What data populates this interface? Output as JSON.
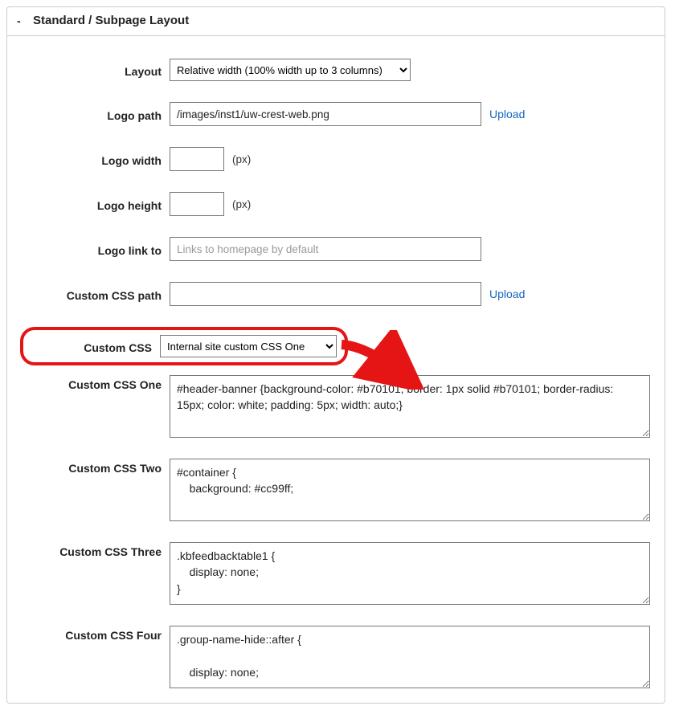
{
  "panel": {
    "title": "Standard / Subpage Layout",
    "toggle_symbol": "-"
  },
  "rows": {
    "layout": {
      "label": "Layout",
      "value": "Relative width (100% width up to 3 columns)"
    },
    "logo_path": {
      "label": "Logo path",
      "value": "/images/inst1/uw-crest-web.png",
      "upload": "Upload"
    },
    "logo_width": {
      "label": "Logo width",
      "value": "",
      "suffix": "(px)"
    },
    "logo_height": {
      "label": "Logo height",
      "value": "",
      "suffix": "(px)"
    },
    "logo_link": {
      "label": "Logo link to",
      "value": "",
      "placeholder": "Links to homepage by default"
    },
    "css_path": {
      "label": "Custom CSS path",
      "value": "",
      "upload": "Upload"
    },
    "custom_css": {
      "label": "Custom CSS",
      "value": "Internal site custom CSS One"
    },
    "css_one": {
      "label": "Custom CSS One",
      "value": "#header-banner {background-color: #b70101; border: 1px solid #b70101; border-radius: 15px; color: white; padding: 5px; width: auto;}"
    },
    "css_two": {
      "label": "Custom CSS Two",
      "value": "#container {\n    background: #cc99ff;"
    },
    "css_three": {
      "label": "Custom CSS Three",
      "value": ".kbfeedbacktable1 {\n    display: none;\n}"
    },
    "css_four": {
      "label": "Custom CSS Four",
      "value": ".group-name-hide::after {\n\n    display: none;"
    }
  }
}
